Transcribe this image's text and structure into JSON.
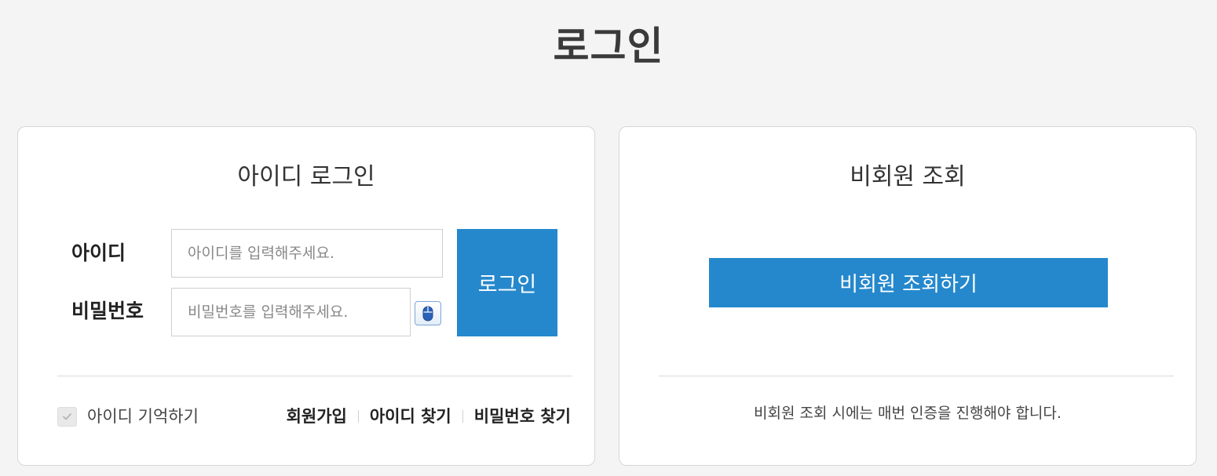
{
  "page": {
    "title": "로그인"
  },
  "id_login": {
    "heading": "아이디 로그인",
    "id_label": "아이디",
    "id_placeholder": "아이디를 입력해주세요.",
    "password_label": "비밀번호",
    "password_placeholder": "비밀번호를 입력해주세요.",
    "keypad_icon": "mouse-keypad-icon",
    "login_button": "로그인",
    "remember_label": "아이디 기억하기",
    "remember_checked": false,
    "links": {
      "signup": "회원가입",
      "find_id": "아이디 찾기",
      "find_password": "비밀번호 찾기"
    }
  },
  "guest": {
    "heading": "비회원 조회",
    "button": "비회원 조회하기",
    "notice": "비회원 조회 시에는 매번 인증을 진행해야 합니다."
  },
  "colors": {
    "background": "#f4f4f4",
    "accent": "#2588cc",
    "card": "#ffffff"
  }
}
